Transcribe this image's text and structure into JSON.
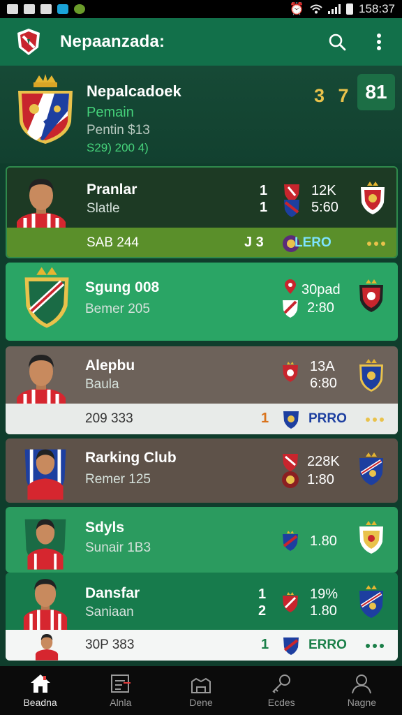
{
  "status_bar": {
    "time": "158:37"
  },
  "app": {
    "title": "Nepaanzada:"
  },
  "header": {
    "name": "Nepalcadoek",
    "sub1": "Pemain",
    "sub2": "Pentin $13",
    "sub3": "S29) 200 4)",
    "score": "3 7",
    "box_value": "81"
  },
  "cards": [
    {
      "name": "Pranlar",
      "sub": "Slatle",
      "num1": "1",
      "num2": "1",
      "stat1": "12K",
      "stat2": "5:60",
      "footer_left": "SAB 244",
      "footer_score": "J 3",
      "footer_badge": "LERO"
    },
    {
      "name": "Sgung 008",
      "sub": "Bemer 205",
      "stat1": "30pad",
      "stat2": "2:80"
    },
    {
      "name": "Alepbu",
      "sub": "Baula",
      "stat1": "13A",
      "stat2": "6:80",
      "footer_left": "209 333",
      "footer_score": "1",
      "footer_badge": "PRRO"
    },
    {
      "name": "Rarking Club",
      "sub": "Remer 125",
      "stat1": "228K",
      "stat2": "1:80"
    },
    {
      "name": "Sdyls",
      "sub": "Sunair 1B3",
      "stat1": "1.80"
    },
    {
      "name": "Dansfar",
      "sub": "Saniaan",
      "num1": "1",
      "num2": "2",
      "stat1": "19%",
      "stat2": "1.80",
      "footer_left": "30P 383",
      "footer_score": "1",
      "footer_badge": "ERRO"
    }
  ],
  "nav": [
    {
      "label": "Beadna",
      "icon": "home-icon"
    },
    {
      "label": "Alnla",
      "icon": "list-icon"
    },
    {
      "label": "Dene",
      "icon": "stadium-icon"
    },
    {
      "label": "Ecdes",
      "icon": "key-icon"
    },
    {
      "label": "Nagne",
      "icon": "profile-icon"
    }
  ],
  "colors": {
    "appbar": "#12704a",
    "accent_gold": "#e9c24b",
    "accent_green": "#46d37b",
    "badge_blue": "#1d3fa0"
  }
}
